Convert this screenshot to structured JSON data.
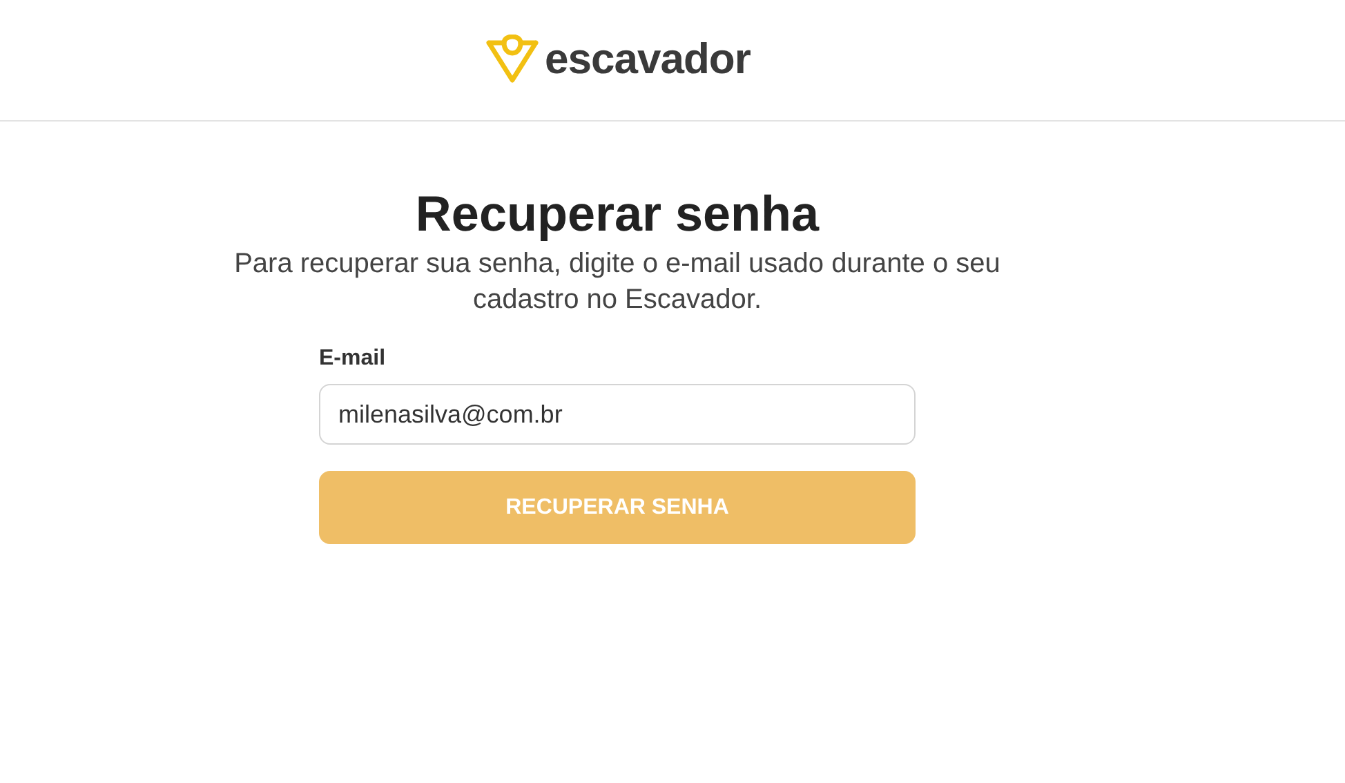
{
  "header": {
    "logo_text": "escavador"
  },
  "title": "Recuperar senha",
  "description": "Para recuperar sua senha, digite o e-mail usado durante o seu cadastro no Escavador.",
  "email_field": {
    "label": "E-mail",
    "value": "milenasilva@com.br"
  },
  "submit_button": {
    "label": "RECUPERAR SENHA",
    "disabled": true
  }
}
